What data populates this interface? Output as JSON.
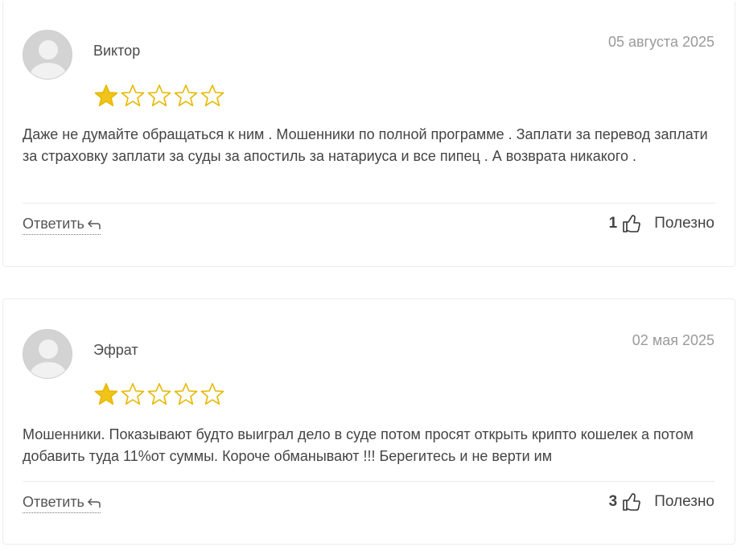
{
  "reviews": [
    {
      "author": "Виктор",
      "date": "05 августа 2025",
      "rating": 1,
      "max_rating": 5,
      "text": "Даже не думайте обращаться к ним . Мошенники по полной программе . Заплати за перевод заплати за страховку заплати за суды за апостиль за натариуса и все пипец . А возврата никакого .",
      "reply_label": "Ответить",
      "helpful_count": "1",
      "helpful_label": "Полезно"
    },
    {
      "author": "Эфрат",
      "date": "02 мая 2025",
      "rating": 1,
      "max_rating": 5,
      "text": "Мошенники. Показывают будто выиграл дело в суде потом просят открыть крипто кошелек а потом добавить туда 11%от суммы. Короче обманывают !!! Берегитесь и не верти им",
      "reply_label": "Ответить",
      "helpful_count": "3",
      "helpful_label": "Полезно"
    }
  ],
  "colors": {
    "star_filled": "#f0c419",
    "star_outline": "#e6b800"
  },
  "icons": {
    "avatar": "user-avatar-icon",
    "star": "star-icon",
    "reply": "reply-arrow-icon",
    "helpful": "thumbs-up-icon"
  }
}
